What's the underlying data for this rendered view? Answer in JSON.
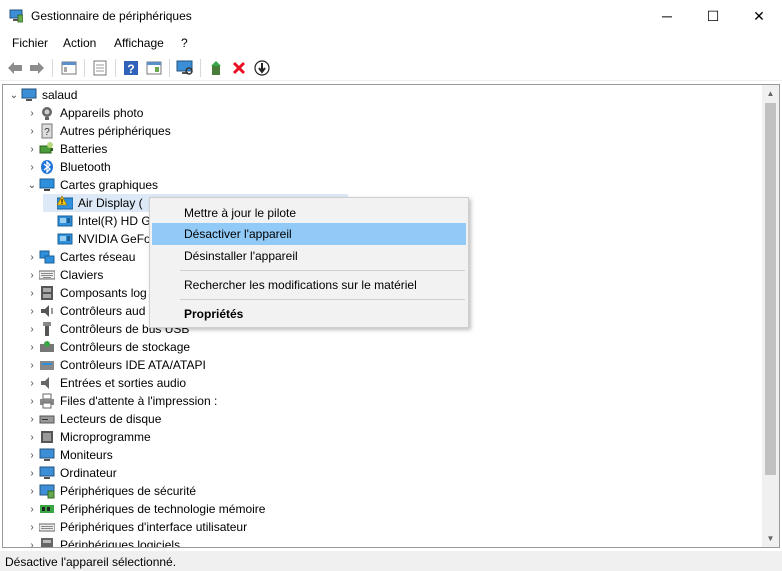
{
  "window": {
    "title": "Gestionnaire de périphériques",
    "controls": {
      "minimize": "─",
      "maximize": "☐",
      "close": "✕"
    }
  },
  "menu": [
    "Fichier",
    "Action",
    "Affichage",
    "?"
  ],
  "tree": {
    "root": "salaud",
    "items": [
      {
        "label": "Appareils photo",
        "icon": "camera-icon"
      },
      {
        "label": "Autres périphériques",
        "icon": "unknown-device-icon"
      },
      {
        "label": "Batteries",
        "icon": "battery-icon"
      },
      {
        "label": "Bluetooth",
        "icon": "bluetooth-icon"
      },
      {
        "label": "Cartes graphiques",
        "icon": "display-adapter-icon"
      },
      {
        "label": "Air Display (",
        "icon": "warning-icon",
        "child": true
      },
      {
        "label": "Intel(R) HD G",
        "icon": "gpu-icon",
        "child": true
      },
      {
        "label": "NVIDIA GeFo",
        "icon": "gpu-icon",
        "child": true
      },
      {
        "label": "Cartes réseau",
        "icon": "network-icon"
      },
      {
        "label": "Claviers",
        "icon": "keyboard-icon"
      },
      {
        "label": "Composants log",
        "icon": "software-component-icon"
      },
      {
        "label": "Contrôleurs aud",
        "icon": "audio-controller-icon"
      },
      {
        "label": "Contrôleurs de bus USB",
        "icon": "usb-icon"
      },
      {
        "label": "Contrôleurs de stockage",
        "icon": "storage-controller-icon"
      },
      {
        "label": "Contrôleurs IDE ATA/ATAPI",
        "icon": "ide-icon"
      },
      {
        "label": "Entrées et sorties audio",
        "icon": "speaker-icon"
      },
      {
        "label": "Files d'attente à l'impression :",
        "icon": "printer-icon"
      },
      {
        "label": "Lecteurs de disque",
        "icon": "disk-drive-icon"
      },
      {
        "label": "Microprogramme",
        "icon": "firmware-icon"
      },
      {
        "label": "Moniteurs",
        "icon": "monitor-icon"
      },
      {
        "label": "Ordinateur",
        "icon": "computer-icon"
      },
      {
        "label": "Périphériques de sécurité",
        "icon": "security-device-icon"
      },
      {
        "label": "Périphériques de technologie mémoire",
        "icon": "memory-tech-icon"
      },
      {
        "label": "Périphériques d'interface utilisateur",
        "icon": "hid-icon"
      },
      {
        "label": "Périphériques logiciels",
        "icon": "software-device-icon"
      }
    ]
  },
  "context_menu": {
    "items": [
      {
        "label": "Mettre à jour le pilote"
      },
      {
        "label": "Désactiver l'appareil",
        "highlighted": true
      },
      {
        "label": "Désinstaller l'appareil"
      },
      {
        "label": "Rechercher les modifications sur le matériel"
      },
      {
        "label": "Propriétés",
        "bold": true
      }
    ]
  },
  "status": "Désactive l'appareil sélectionné.",
  "colors": {
    "accent": "#91c9f7",
    "selection": "#dde9f7",
    "error_red": "#e81123"
  }
}
